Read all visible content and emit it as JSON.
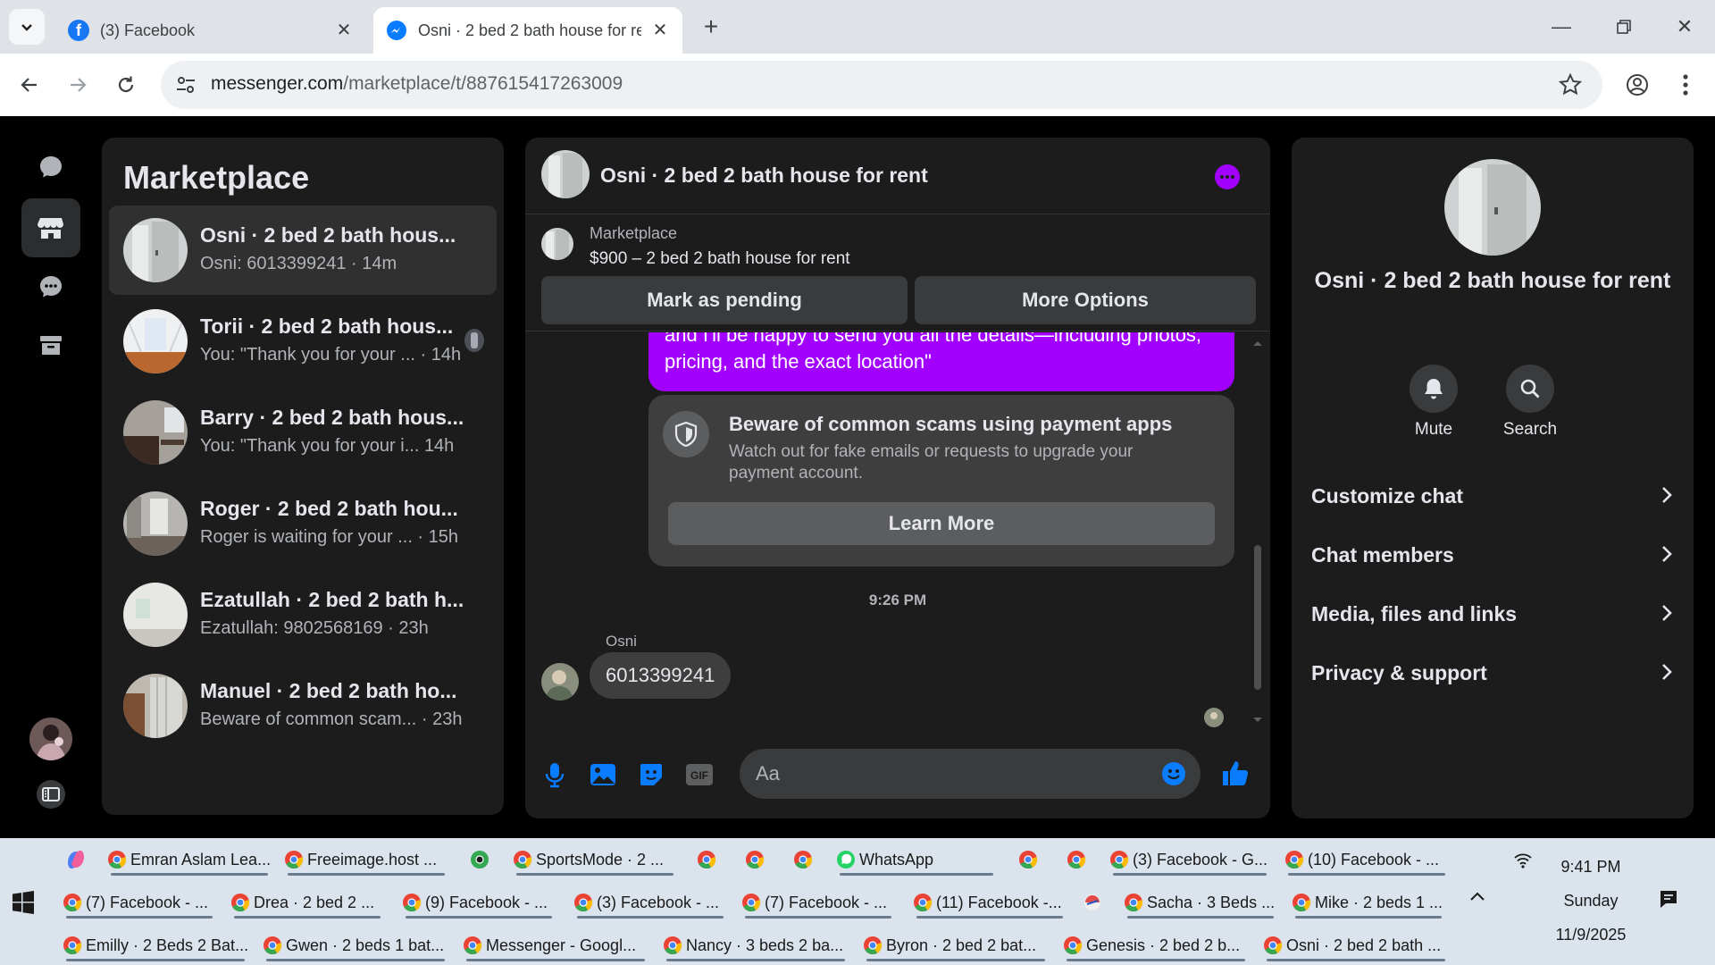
{
  "browser": {
    "tabs": [
      {
        "title": "(3) Facebook",
        "active": false
      },
      {
        "title": "Osni · 2 bed 2 bath house for re",
        "active": true
      }
    ],
    "url_host": "messenger.com",
    "url_path": "/marketplace/t/887615417263009"
  },
  "sidebar_list": {
    "title": "Marketplace",
    "conversations": [
      {
        "name": "Osni · 2 bed 2 bath hous...",
        "snippet": "Osni: 6013399241 · 14m",
        "active": true
      },
      {
        "name": "Torii · 2 bed 2 bath hous...",
        "snippet": "You: \"Thank you for your ... · 14h",
        "active": false
      },
      {
        "name": "Barry · 2 bed 2 bath hous...",
        "snippet": "You: \"Thank you for your i... 14h",
        "active": false
      },
      {
        "name": "Roger · 2 bed 2 bath hou...",
        "snippet": "Roger is waiting for your ... · 15h",
        "active": false
      },
      {
        "name": "Ezatullah · 2 bed 2 bath h...",
        "snippet": "Ezatullah: 9802568169 · 23h",
        "active": false
      },
      {
        "name": "Manuel · 2 bed 2 bath ho...",
        "snippet": "Beware of common scam... · 23h",
        "active": false
      }
    ]
  },
  "chat": {
    "title": "Osni · 2 bed 2 bath house for rent",
    "listing_source": "Marketplace",
    "listing_price": "$900 – 2 bed 2 bath house for rent",
    "mark_pending_label": "Mark as pending",
    "more_options_label": "More Options",
    "outgoing_text": "and I'll be happy to send you all the details—including photos, pricing, and the exact location\"",
    "scam_title": "Beware of common scams using payment apps",
    "scam_body": "Watch out for fake emails or requests to upgrade your payment account.",
    "learn_more_label": "Learn More",
    "timestamp": "9:26 PM",
    "sender_name": "Osni",
    "incoming_text": "6013399241",
    "input_placeholder": "Aa"
  },
  "info": {
    "name": "Osni · 2 bed 2 bath house for rent",
    "mute_label": "Mute",
    "search_label": "Search",
    "rows": [
      "Customize chat",
      "Chat members",
      "Media, files and links",
      "Privacy & support"
    ]
  },
  "taskbar": {
    "row1": [
      "Emran Aslam Lea...",
      "Freeimage.host ...",
      "SportsMode · 2 ...",
      "WhatsApp",
      "(3) Facebook - G...",
      "(10) Facebook - ..."
    ],
    "row2": [
      "(7) Facebook - ...",
      "Drea · 2 bed 2 ...",
      "(9) Facebook - ...",
      "(3) Facebook - ...",
      "(7) Facebook - ...",
      "(11) Facebook -...",
      "Sacha · 3 Beds ...",
      "Mike · 2 beds 1 ..."
    ],
    "row3": [
      "Emilly · 2 Beds 2 Bat...",
      "Gwen · 2 beds 1 bat...",
      "Messenger - Googl...",
      "Nancy · 3 beds 2 ba...",
      "Byron · 2 bed 2 bat...",
      "Genesis · 2 bed 2 b...",
      "Osni · 2 bed 2 bath ..."
    ],
    "time": "9:41 PM",
    "day": "Sunday",
    "date": "11/9/2025"
  },
  "colors": {
    "accent": "#a200ff",
    "messenger_blue": "#0a7cff",
    "panel": "#1c1c1d"
  }
}
